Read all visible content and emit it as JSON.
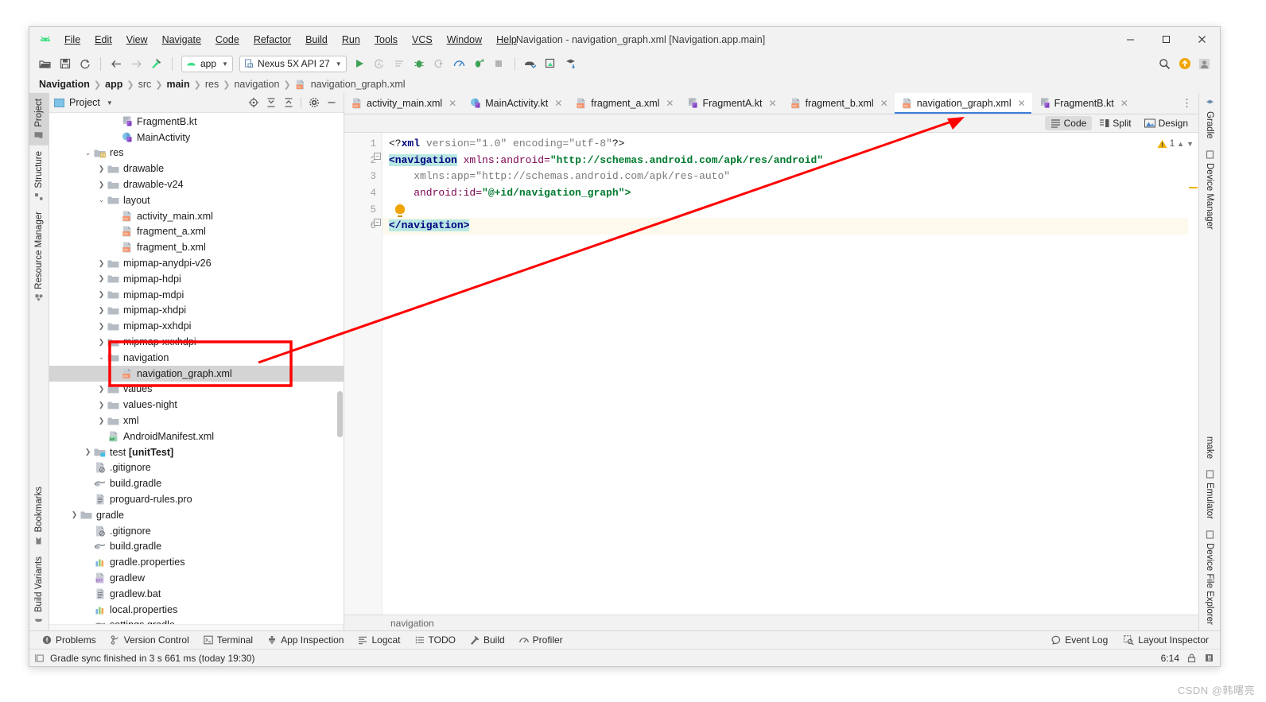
{
  "window": {
    "title": "Navigation - navigation_graph.xml [Navigation.app.main]",
    "minimize": "─",
    "maximize": "☐",
    "close": "✕"
  },
  "menubar": [
    {
      "label": "File"
    },
    {
      "label": "Edit"
    },
    {
      "label": "View"
    },
    {
      "label": "Navigate"
    },
    {
      "label": "Code"
    },
    {
      "label": "Refactor"
    },
    {
      "label": "Build"
    },
    {
      "label": "Run"
    },
    {
      "label": "Tools"
    },
    {
      "label": "VCS"
    },
    {
      "label": "Window"
    },
    {
      "label": "Help"
    }
  ],
  "toolbar": {
    "module_selector": "app",
    "device_selector": "Nexus 5X API 27",
    "icons": [
      "open-folder-icon",
      "save-all-icon",
      "sync-icon",
      "back-icon",
      "forward-icon",
      "build-hammer-icon",
      "run-icon",
      "apply-changes-icon",
      "apply-code-changes-icon",
      "debug-icon",
      "attach-debugger-icon",
      "profiler-icon",
      "run-with-coverage-icon",
      "stop-icon",
      "sdk-manager-icon",
      "avd-manager-icon",
      "gradle-sync-icon",
      "search-everywhere-icon",
      "update-icon",
      "account-icon"
    ]
  },
  "breadcrumb": [
    {
      "label": "Navigation",
      "bold": true
    },
    {
      "label": "app",
      "bold": true
    },
    {
      "label": "src",
      "bold": false
    },
    {
      "label": "main",
      "bold": true
    },
    {
      "label": "res",
      "bold": false
    },
    {
      "label": "navigation",
      "bold": false
    },
    {
      "label": "navigation_graph.xml",
      "bold": false,
      "icon": "xml-file-icon"
    }
  ],
  "left_strip": [
    {
      "label": "Project",
      "icon": "project-icon",
      "active": true
    },
    {
      "label": "Structure",
      "icon": "structure-icon",
      "active": false
    },
    {
      "label": "Resource Manager",
      "icon": "resource-manager-icon",
      "active": false
    },
    {
      "label": "Bookmarks",
      "icon": "bookmark-icon",
      "active": false
    },
    {
      "label": "Build Variants",
      "icon": "build-variants-icon",
      "active": false
    }
  ],
  "right_strip_top": [
    {
      "label": "Gradle",
      "icon": "gradle-icon"
    },
    {
      "label": "Device Manager",
      "icon": "device-manager-icon"
    }
  ],
  "right_strip_bottom": [
    {
      "label": "make",
      "icon": "make-icon"
    },
    {
      "label": "Emulator",
      "icon": "emulator-icon"
    },
    {
      "label": "Device File Explorer",
      "icon": "device-file-explorer-icon"
    }
  ],
  "project_panel": {
    "title": "Project",
    "actions": [
      "locate-icon",
      "expand-all-icon",
      "collapse-all-icon",
      "settings-gear-icon",
      "hide-icon"
    ],
    "tree": [
      {
        "label": "FragmentB.kt",
        "depth": 4,
        "arrow": "none",
        "icon": "kotlin-class-icon"
      },
      {
        "label": "MainActivity",
        "depth": 4,
        "arrow": "none",
        "icon": "kotlin-activity-icon"
      },
      {
        "label": "res",
        "depth": 2,
        "arrow": "open",
        "icon": "res-folder-icon"
      },
      {
        "label": "drawable",
        "depth": 3,
        "arrow": "closed",
        "icon": "folder-icon"
      },
      {
        "label": "drawable-v24",
        "depth": 3,
        "arrow": "closed",
        "icon": "folder-icon"
      },
      {
        "label": "layout",
        "depth": 3,
        "arrow": "open",
        "icon": "folder-icon"
      },
      {
        "label": "activity_main.xml",
        "depth": 4,
        "arrow": "none",
        "icon": "xml-file-icon"
      },
      {
        "label": "fragment_a.xml",
        "depth": 4,
        "arrow": "none",
        "icon": "xml-file-icon"
      },
      {
        "label": "fragment_b.xml",
        "depth": 4,
        "arrow": "none",
        "icon": "xml-file-icon"
      },
      {
        "label": "mipmap-anydpi-v26",
        "depth": 3,
        "arrow": "closed",
        "icon": "folder-icon"
      },
      {
        "label": "mipmap-hdpi",
        "depth": 3,
        "arrow": "closed",
        "icon": "folder-icon"
      },
      {
        "label": "mipmap-mdpi",
        "depth": 3,
        "arrow": "closed",
        "icon": "folder-icon"
      },
      {
        "label": "mipmap-xhdpi",
        "depth": 3,
        "arrow": "closed",
        "icon": "folder-icon"
      },
      {
        "label": "mipmap-xxhdpi",
        "depth": 3,
        "arrow": "closed",
        "icon": "folder-icon"
      },
      {
        "label": "mipmap-xxxhdpi",
        "depth": 3,
        "arrow": "closed",
        "icon": "folder-icon"
      },
      {
        "label": "navigation",
        "depth": 3,
        "arrow": "open",
        "icon": "folder-icon"
      },
      {
        "label": "navigation_graph.xml",
        "depth": 4,
        "arrow": "none",
        "icon": "xml-file-icon",
        "selected": true
      },
      {
        "label": "values",
        "depth": 3,
        "arrow": "closed",
        "icon": "folder-icon"
      },
      {
        "label": "values-night",
        "depth": 3,
        "arrow": "closed",
        "icon": "folder-icon"
      },
      {
        "label": "xml",
        "depth": 3,
        "arrow": "closed",
        "icon": "folder-icon"
      },
      {
        "label": "AndroidManifest.xml",
        "depth": 3,
        "arrow": "none",
        "icon": "manifest-file-icon"
      },
      {
        "label": "test [unitTest]",
        "depth": 2,
        "arrow": "closed",
        "icon": "test-folder-icon",
        "bold_suffix": "[unitTest]"
      },
      {
        "label": ".gitignore",
        "depth": 2,
        "arrow": "none",
        "icon": "gitignore-file-icon"
      },
      {
        "label": "build.gradle",
        "depth": 2,
        "arrow": "none",
        "icon": "gradle-file-icon"
      },
      {
        "label": "proguard-rules.pro",
        "depth": 2,
        "arrow": "none",
        "icon": "text-file-icon"
      },
      {
        "label": "gradle",
        "depth": 1,
        "arrow": "closed",
        "icon": "folder-icon"
      },
      {
        "label": ".gitignore",
        "depth": 2,
        "arrow": "none",
        "icon": "gitignore-file-icon"
      },
      {
        "label": "build.gradle",
        "depth": 2,
        "arrow": "none",
        "icon": "gradle-file-icon"
      },
      {
        "label": "gradle.properties",
        "depth": 2,
        "arrow": "none",
        "icon": "properties-file-icon"
      },
      {
        "label": "gradlew",
        "depth": 2,
        "arrow": "none",
        "icon": "cpp-file-icon"
      },
      {
        "label": "gradlew.bat",
        "depth": 2,
        "arrow": "none",
        "icon": "text-file-icon"
      },
      {
        "label": "local.properties",
        "depth": 2,
        "arrow": "none",
        "icon": "properties-file-icon"
      },
      {
        "label": "settings.gradle",
        "depth": 2,
        "arrow": "none",
        "icon": "gradle-file-icon"
      }
    ]
  },
  "editor_tabs": [
    {
      "label": "activity_main.xml",
      "icon": "xml-file-icon",
      "active": false
    },
    {
      "label": "MainActivity.kt",
      "icon": "kotlin-activity-icon",
      "active": false
    },
    {
      "label": "fragment_a.xml",
      "icon": "xml-file-icon",
      "active": false
    },
    {
      "label": "FragmentA.kt",
      "icon": "kotlin-class-icon",
      "active": false
    },
    {
      "label": "fragment_b.xml",
      "icon": "xml-file-icon",
      "active": false
    },
    {
      "label": "navigation_graph.xml",
      "icon": "xml-file-icon",
      "active": true
    },
    {
      "label": "FragmentB.kt",
      "icon": "kotlin-class-icon",
      "active": false
    }
  ],
  "view_switch": [
    {
      "label": "Code",
      "icon": "code-view-icon",
      "active": true
    },
    {
      "label": "Split",
      "icon": "split-view-icon",
      "active": false
    },
    {
      "label": "Design",
      "icon": "design-view-icon",
      "active": false
    }
  ],
  "editor": {
    "warning_count": "1",
    "line_numbers": [
      "1",
      "2",
      "3",
      "4",
      "5",
      "6"
    ],
    "code_lines": [
      {
        "n": 1,
        "tokens": [
          {
            "t": "<?",
            "c": "tok-punct"
          },
          {
            "t": "xml",
            "c": "tok-decl"
          },
          {
            "t": " version=",
            "c": "tok-attr2"
          },
          {
            "t": "\"1.0\"",
            "c": "tok-str2"
          },
          {
            "t": " encoding=",
            "c": "tok-attr2"
          },
          {
            "t": "\"utf-8\"",
            "c": "tok-str2"
          },
          {
            "t": "?>",
            "c": "tok-punct"
          }
        ]
      },
      {
        "n": 2,
        "tokens": [
          {
            "t": "<navigation",
            "c": "tok-tag-hl"
          },
          {
            "t": " xmlns:android=",
            "c": "tok-attr"
          },
          {
            "t": "\"http://schemas.android.com/apk/res/android\"",
            "c": "tok-str"
          }
        ]
      },
      {
        "n": 3,
        "tokens": [
          {
            "t": "    xmlns:app=",
            "c": "tok-attr2"
          },
          {
            "t": "\"http://schemas.android.com/apk/res-auto\"",
            "c": "tok-str2"
          }
        ]
      },
      {
        "n": 4,
        "tokens": [
          {
            "t": "    android:id=",
            "c": "tok-attr"
          },
          {
            "t": "\"@+id/navigation_graph\">",
            "c": "tok-str"
          }
        ]
      },
      {
        "n": 5,
        "tokens": []
      },
      {
        "n": 6,
        "tokens": [
          {
            "t": "</navigation>",
            "c": "tok-tag-hl"
          }
        ]
      }
    ],
    "hint_bar": "navigation"
  },
  "bottom_tabs": [
    {
      "label": "Problems",
      "icon": "problems-icon"
    },
    {
      "label": "Version Control",
      "icon": "version-control-icon"
    },
    {
      "label": "Terminal",
      "icon": "terminal-icon"
    },
    {
      "label": "App Inspection",
      "icon": "app-inspection-icon"
    },
    {
      "label": "Logcat",
      "icon": "logcat-icon"
    },
    {
      "label": "TODO",
      "icon": "todo-icon"
    },
    {
      "label": "Build",
      "icon": "build-hammer-icon"
    },
    {
      "label": "Profiler",
      "icon": "profiler-icon"
    }
  ],
  "bottom_tabs_right": [
    {
      "label": "Event Log",
      "icon": "event-log-icon"
    },
    {
      "label": "Layout Inspector",
      "icon": "layout-inspector-icon"
    }
  ],
  "statusbar": {
    "message": "Gradle sync finished in 3 s 661 ms (today 19:30)",
    "caret_position": "6:14",
    "lock_icon": "lock-icon",
    "notification_icon": "notification-icon"
  },
  "watermark": "CSDN @韩曙亮",
  "annotation": {
    "highlight_color": "#ff0000",
    "box_target": "navigation-folder-and-navigation_graph.xml",
    "arrow_target": "navigation_graph.xml-editor-tab"
  }
}
